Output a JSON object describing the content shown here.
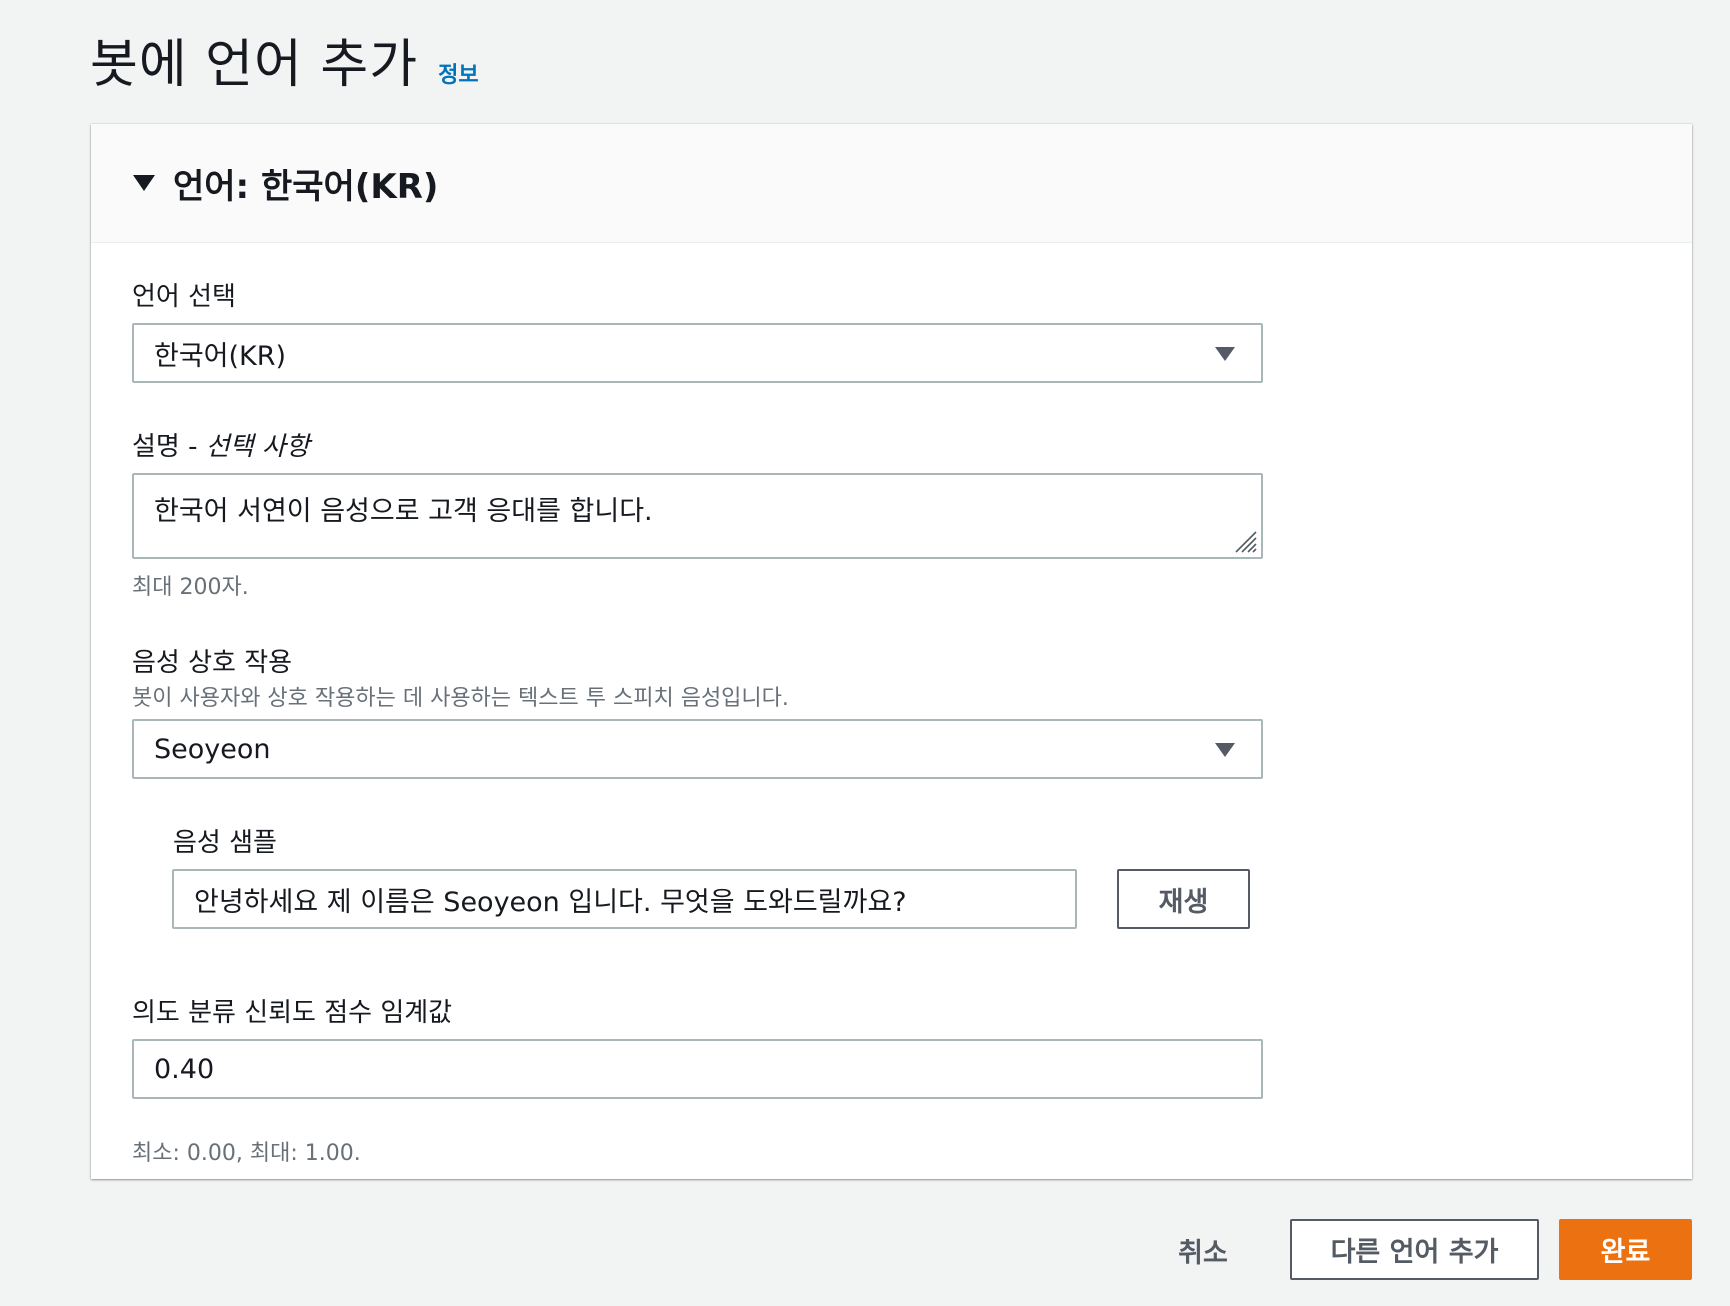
{
  "header": {
    "title": "봇에 언어 추가",
    "info_link": "정보"
  },
  "panel": {
    "title": "언어: 한국어(KR)",
    "language": {
      "label": "언어 선택",
      "value": "한국어(KR)"
    },
    "description": {
      "label": "설명 - ",
      "label_optional": "선택 사항",
      "value": "한국어 서연이 음성으로 고객 응대를 합니다.",
      "hint": "최대 200자."
    },
    "voice": {
      "label": "음성 상호 작용",
      "hint": "봇이 사용자와 상호 작용하는 데 사용하는 텍스트 투 스피치 음성입니다.",
      "value": "Seoyeon"
    },
    "voice_sample": {
      "label": "음성 샘플",
      "value": "안녕하세요 제 이름은 Seoyeon 입니다. 무엇을 도와드릴까요?",
      "play_button": "재생"
    },
    "threshold": {
      "label": "의도 분류 신뢰도 점수 임계값",
      "value": "0.40",
      "hint": "최소: 0.00, 최대: 1.00."
    }
  },
  "footer": {
    "cancel": "취소",
    "add_another": "다른 언어 추가",
    "done": "완료"
  },
  "colors": {
    "primary": "#ec7211",
    "link": "#0073bb",
    "border": "#aab7b8"
  }
}
